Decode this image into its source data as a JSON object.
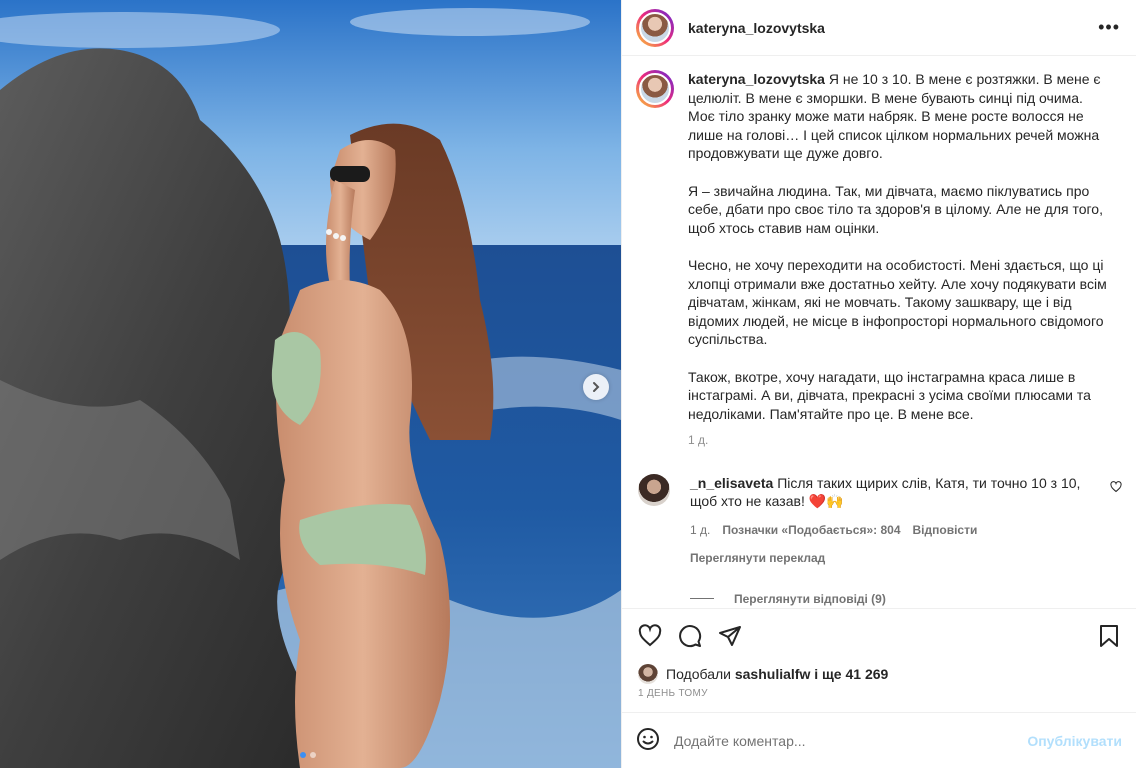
{
  "post": {
    "username": "kateryna_lozovytska",
    "more_icon": "more-horizontal-icon",
    "caption_paragraphs": [
      "Я не 10 з 10. В мене є розтяжки. В мене є целюліт. В мене є зморшки. В мене бувають синці під очима. Моє тіло зранку може мати набряк. В мене росте волосся не лише на голові… І цей список цілком нормальних речей можна продовжувати ще дуже довго.",
      "Я – звичайна людина. Так, ми дівчата, маємо піклуватись про себе, дбати про своє тіло та здоров'я в цілому. Але не для того, щоб хтось ставив нам оцінки.",
      "Чесно, не хочу переходити на особистості. Мені здається, що ці хлопці отримали вже достатньо хейту. Але хочу подякувати всім дівчатам, жінкам, які не мовчать. Такому зашквару, ще і від відомих людей, не місце в інфопросторі нормального свідомого суспільства.",
      "Також, вкотре, хочу нагадати, що інстаграмна краса лише в інстаграмі. А ви, дівчата, прекрасні з усіма своїми плюсами та недоліками. Пам'ятайте про це. В мене все."
    ],
    "caption_time": "1 д."
  },
  "comment": {
    "username": "_n_elisaveta",
    "text": "Після таких щирих слів, Катя, ти точно 10 з 10, щоб хто не казав! ❤️🙌",
    "time": "1 д.",
    "likes_label": "Позначки «Подобається»: 804",
    "reply_label": "Відповісти",
    "translate_label": "Переглянути переклад",
    "replies_label": "Переглянути відповіді (9)"
  },
  "likes": {
    "prefix": "Подобали",
    "user": "sashulialfw",
    "suffix": "і ще 41 269"
  },
  "posted_time": "1 ДЕНЬ ТОМУ",
  "comment_input": {
    "placeholder": "Додайте коментар...",
    "publish_label": "Опублікувати"
  },
  "carousel": {
    "total": 2,
    "active_index": 0
  },
  "colors": {
    "publish_disabled": "#b2dffc",
    "dot_active": "#3b8ff3"
  }
}
